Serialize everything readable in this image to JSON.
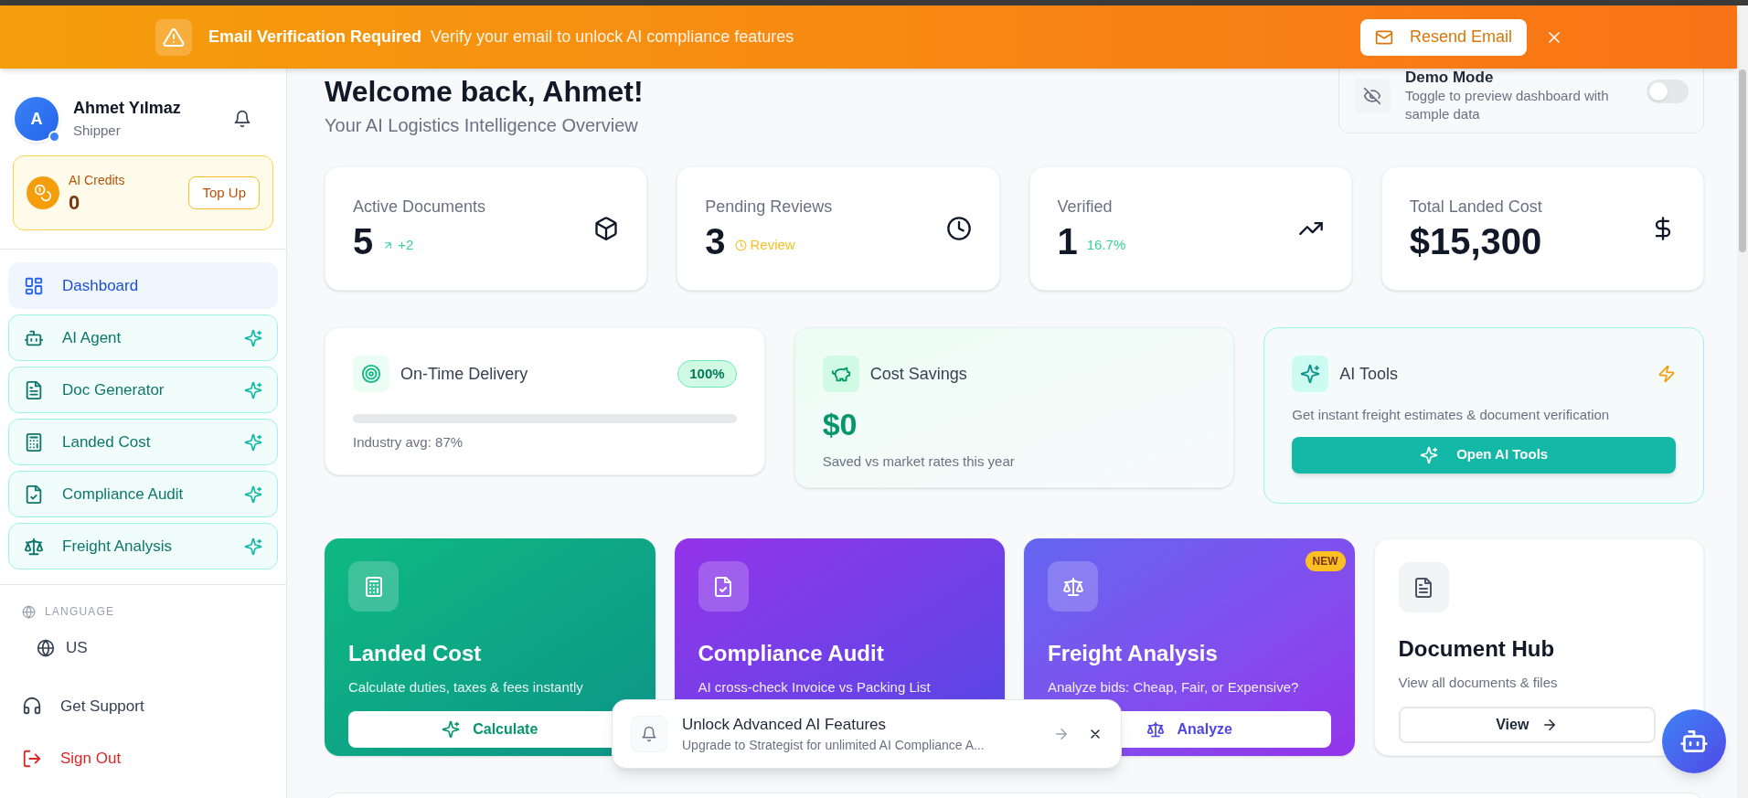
{
  "banner": {
    "title": "Email Verification Required",
    "message": "Verify your email to unlock AI compliance features",
    "button": "Resend Email"
  },
  "user": {
    "initial": "A",
    "name": "Ahmet Yılmaz",
    "role": "Shipper"
  },
  "credits": {
    "label": "AI Credits",
    "value": "0",
    "button": "Top Up"
  },
  "nav": [
    {
      "label": "Dashboard",
      "selected": true,
      "kind": "page"
    },
    {
      "label": "AI Agent",
      "selected": false,
      "kind": "ai"
    },
    {
      "label": "Doc Generator",
      "selected": false,
      "kind": "ai"
    },
    {
      "label": "Landed Cost",
      "selected": false,
      "kind": "ai"
    },
    {
      "label": "Compliance Audit",
      "selected": false,
      "kind": "ai"
    },
    {
      "label": "Freight Analysis",
      "selected": false,
      "kind": "ai"
    }
  ],
  "language": {
    "heading": "LANGUAGE",
    "value": "US"
  },
  "footer_links": [
    {
      "label": "Get Support",
      "kind": "support"
    },
    {
      "label": "Sign Out",
      "kind": "signout"
    }
  ],
  "header": {
    "title": "Welcome back, Ahmet!",
    "subtitle": "Your AI Logistics Intelligence Overview"
  },
  "demo_mode": {
    "title": "Demo Mode",
    "description": "Toggle to preview dashboard with sample data",
    "on": false
  },
  "stats": [
    {
      "label": "Active Documents",
      "value": "5",
      "delta": "+2",
      "kind": "up"
    },
    {
      "label": "Pending Reviews",
      "value": "3",
      "delta": "Review",
      "kind": "pending"
    },
    {
      "label": "Verified",
      "value": "1",
      "delta": "16.7%",
      "kind": "percent"
    },
    {
      "label": "Total Landed Cost",
      "value": "$15,300"
    }
  ],
  "on_time": {
    "title": "On-Time Delivery",
    "badge": "100%",
    "level": 0,
    "note": "Industry avg: 87%"
  },
  "savings": {
    "title": "Cost Savings",
    "value": "$0",
    "note": "Saved vs market rates this year"
  },
  "ai_tools": {
    "title": "AI Tools",
    "description": "Get instant freight estimates & document verification",
    "button": "Open AI Tools"
  },
  "features": [
    {
      "title": "Landed Cost",
      "description": "Calculate duties, taxes & fees instantly",
      "button": "Calculate",
      "kind": "green",
      "new": false
    },
    {
      "title": "Compliance Audit",
      "description": "AI cross-check Invoice vs Packing List",
      "kind": "purple",
      "new": false
    },
    {
      "title": "Freight Analysis",
      "description": "Analyze bids: Cheap, Fair, or Expensive?",
      "button": "Analyze",
      "kind": "violet",
      "new": true,
      "badge": "NEW"
    },
    {
      "title": "Document Hub",
      "description": "View all documents & files",
      "button": "View",
      "kind": "plain",
      "new": false
    }
  ],
  "toast": {
    "title": "Unlock Advanced AI Features",
    "message": "Upgrade to Strategist for unlimited AI Compliance A..."
  }
}
